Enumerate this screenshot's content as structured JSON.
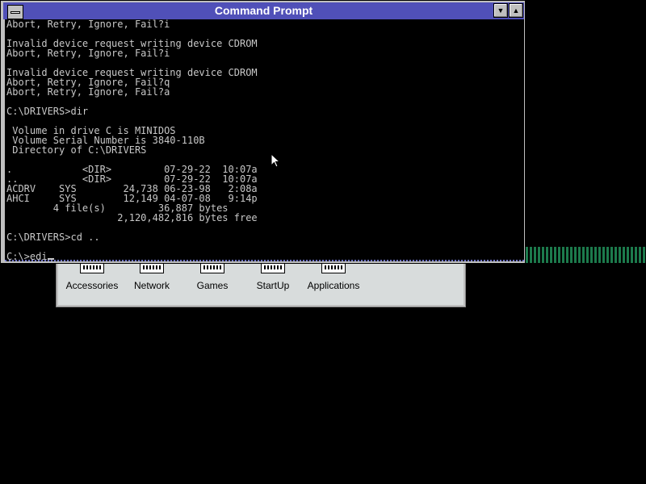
{
  "window": {
    "title": "Command Prompt",
    "min_button": "▼",
    "max_button": "▲"
  },
  "console": {
    "lines": [
      "Abort, Retry, Ignore, Fail?i",
      "",
      "Invalid device request writing device CDROM",
      "Abort, Retry, Ignore, Fail?i",
      "",
      "Invalid device request writing device CDROM",
      "Abort, Retry, Ignore, Fail?q",
      "Abort, Retry, Ignore, Fail?a",
      "",
      "C:\\DRIVERS>dir",
      "",
      " Volume in drive C is MINIDOS",
      " Volume Serial Number is 3840-110B",
      " Directory of C:\\DRIVERS",
      "",
      ".            <DIR>         07-29-22  10:07a",
      "..           <DIR>         07-29-22  10:07a",
      "ACDRV    SYS        24,738 06-23-98   2:08a",
      "AHCI     SYS        12,149 04-07-08   9:14p",
      "        4 file(s)         36,887 bytes",
      "                   2,120,482,816 bytes free",
      "",
      "C:\\DRIVERS>cd ..",
      ""
    ],
    "prompt_input": "C:\\>edi"
  },
  "group_window": {
    "icons": [
      {
        "label": "Accessories",
        "icon": "program-group-icon"
      },
      {
        "label": "Network",
        "icon": "program-group-icon"
      },
      {
        "label": "Games",
        "icon": "program-group-icon"
      },
      {
        "label": "StartUp",
        "icon": "program-group-icon"
      },
      {
        "label": "Applications",
        "icon": "program-group-icon"
      }
    ]
  },
  "colors": {
    "titlebar": "#5050b8",
    "console_bg": "#000000",
    "console_fg": "#c8c8c8",
    "strip": "#1c7a4c"
  }
}
